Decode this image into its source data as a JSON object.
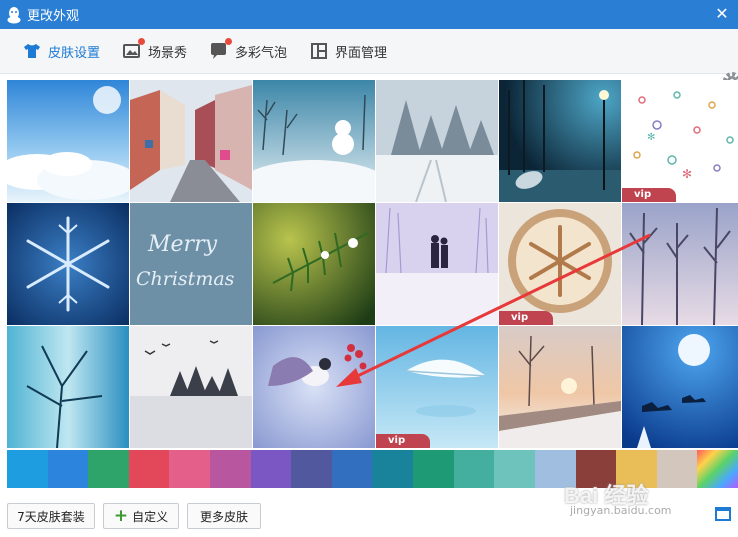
{
  "window": {
    "title": "更改外观",
    "close_glyph": "✕"
  },
  "toolbar": {
    "tabs": [
      {
        "label": "皮肤设置",
        "icon": "tshirt-icon",
        "active": true,
        "badge": false
      },
      {
        "label": "场景秀",
        "icon": "image-icon",
        "active": false,
        "badge": true
      },
      {
        "label": "多彩气泡",
        "icon": "chat-bubble-icon",
        "active": false,
        "badge": true
      },
      {
        "label": "界面管理",
        "icon": "layout-icon",
        "active": false,
        "badge": false
      }
    ],
    "settings_icon": "gear-icon"
  },
  "skins": [
    {
      "name": "sky-clouds",
      "vip": false
    },
    {
      "name": "snowy-street",
      "vip": false
    },
    {
      "name": "snowman",
      "vip": false
    },
    {
      "name": "snowy-trees",
      "vip": false
    },
    {
      "name": "night-lamp-umbrella",
      "vip": false
    },
    {
      "name": "snowflake-pattern",
      "vip": true
    },
    {
      "name": "blue-snowflake",
      "vip": false
    },
    {
      "name": "merry-christmas-frost",
      "vip": false,
      "text": "Merry Christmas"
    },
    {
      "name": "pine-branch",
      "vip": false
    },
    {
      "name": "couple-in-snow",
      "vip": false
    },
    {
      "name": "latte-art-snowflake",
      "vip": true
    },
    {
      "name": "misty-trees",
      "vip": false
    },
    {
      "name": "frozen-branches",
      "vip": false
    },
    {
      "name": "winter-lake-birds",
      "vip": false
    },
    {
      "name": "bird-berries",
      "vip": false
    },
    {
      "name": "white-feather",
      "vip": true
    },
    {
      "name": "snowy-bridge",
      "vip": false
    },
    {
      "name": "moon-reindeer",
      "vip": false
    }
  ],
  "vip_label": "vip",
  "swatches": [
    "#1e9ee0",
    "#2d84dd",
    "#2fa46a",
    "#e2485a",
    "#e45f8a",
    "#b8569f",
    "#7a57c2",
    "#52589e",
    "#326fbe",
    "#18839a",
    "#1e9a74",
    "#44ae9f",
    "#6ec4bc",
    "#a0bfe0",
    "#8a3f3b",
    "#e9bd57",
    "#d3c7bd",
    "rainbow"
  ],
  "bottom": {
    "btn_package": "7天皮肤套装",
    "btn_custom": "自定义",
    "btn_more": "更多皮肤"
  },
  "watermark": {
    "main": "Bai 经验",
    "sub": "jingyan.baidu.com"
  }
}
